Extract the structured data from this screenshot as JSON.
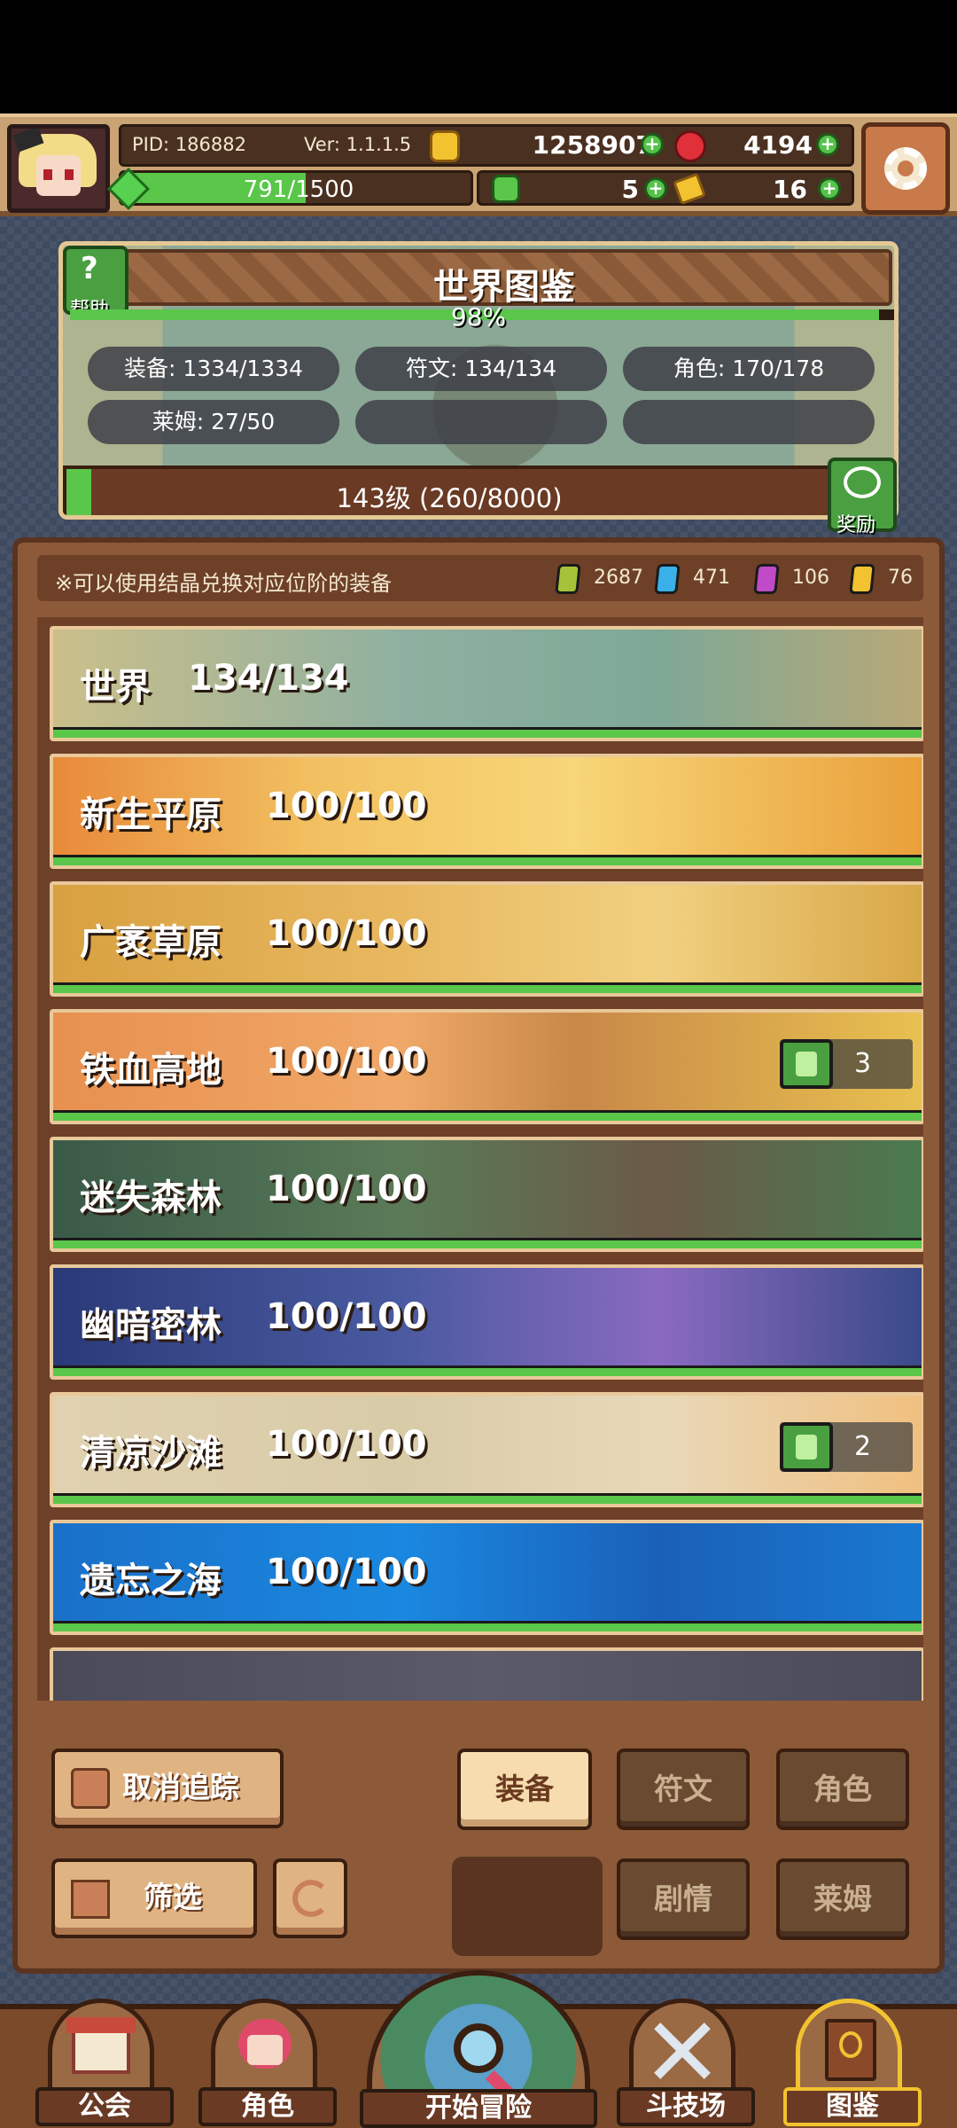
{
  "player": {
    "pid": "PID: 186882",
    "version": "Ver: 1.1.1.5",
    "coins": "1258907",
    "gems": "4194",
    "xp": "791/1500",
    "xp_fraction": 0.527,
    "clovers": "5",
    "keys": "16"
  },
  "codex": {
    "title": "世界图鉴",
    "help_label": "帮助",
    "percent": "98%",
    "percent_value": 0.98,
    "stats": {
      "equipment": "装备: 1334/1334",
      "runes": "符文: 134/134",
      "characters": "角色: 170/178",
      "slimes": "莱姆: 27/50"
    },
    "level": "143级 (260/8000)",
    "level_fraction": 0.0325,
    "reward_label": "奖励"
  },
  "list": {
    "hint": "※可以使用结晶兑换对应位阶的装备",
    "crystals": [
      {
        "color": "#a6c23a",
        "value": "2687"
      },
      {
        "color": "#3ab0e8",
        "value": "471"
      },
      {
        "color": "#c04ac8",
        "value": "106"
      },
      {
        "color": "#f2c230",
        "value": "76"
      }
    ],
    "regions": [
      {
        "name": "世界",
        "count": "134/134",
        "thumbs": ""
      },
      {
        "name": "新生平原",
        "count": "100/100",
        "thumbs": ""
      },
      {
        "name": "广袤草原",
        "count": "100/100",
        "thumbs": ""
      },
      {
        "name": "铁血高地",
        "count": "100/100",
        "thumbs": "3"
      },
      {
        "name": "迷失森林",
        "count": "100/100",
        "thumbs": ""
      },
      {
        "name": "幽暗密林",
        "count": "100/100",
        "thumbs": ""
      },
      {
        "name": "清凉沙滩",
        "count": "100/100",
        "thumbs": "2"
      },
      {
        "name": "遗忘之海",
        "count": "100/100",
        "thumbs": ""
      }
    ]
  },
  "controls": {
    "untrack": "取消追踪",
    "filter": "筛选",
    "tab_equipment": "装备",
    "tab_runes": "符文",
    "tab_characters": "角色",
    "tab_story": "剧情",
    "tab_slime": "莱姆"
  },
  "nav": {
    "guild": "公会",
    "character": "角色",
    "adventure": "开始冒险",
    "arena": "斗技场",
    "codex": "图鉴"
  }
}
